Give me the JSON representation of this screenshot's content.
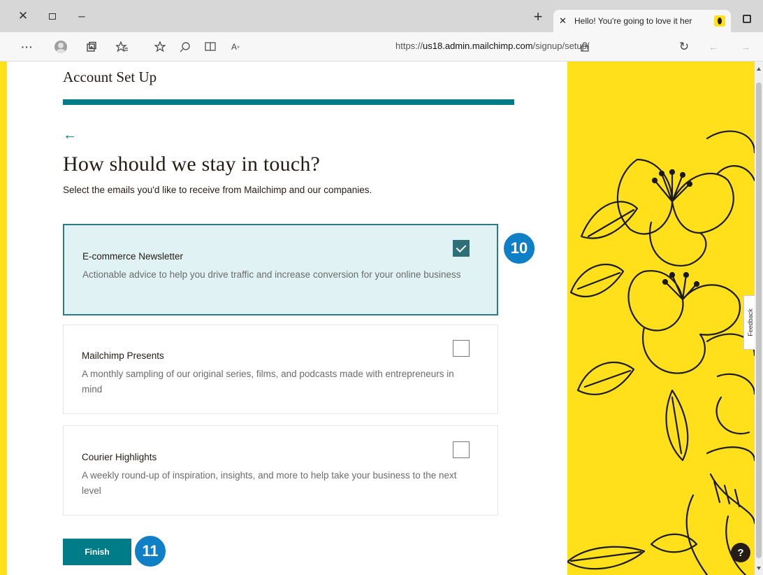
{
  "browser": {
    "tab_title": "Hello! You're going to love it her",
    "url_prefix": "https://",
    "url_domain": "us18.admin.mailchimp.com",
    "url_path": "/signup/setup/",
    "icons": {
      "close": "close-icon",
      "restore": "restore-icon",
      "minimize": "minimize-icon",
      "new_tab": "plus-icon",
      "more": "more-icon",
      "profile": "profile-icon",
      "collections": "collections-icon",
      "favorites": "favorites-icon",
      "add_favorite": "add-favorite-icon",
      "zoom": "zoom-icon",
      "immersive": "immersive-reader-icon",
      "read_aloud": "read-aloud-icon",
      "lock": "lock-icon",
      "refresh": "refresh-icon",
      "back": "back-icon",
      "forward": "forward-icon"
    }
  },
  "page": {
    "setup_title": "Account Set Up",
    "heading": "How should we stay in touch?",
    "subheading": "Select the emails you'd like to receive from Mailchimp and our companies.",
    "options": [
      {
        "name": "E-commerce Newsletter",
        "description": "Actionable advice to help you drive traffic and increase conversion for your online business",
        "checked": true
      },
      {
        "name": "Mailchimp Presents",
        "description": "A monthly sampling of our original series, films, and podcasts made with entrepreneurs in mind",
        "checked": false
      },
      {
        "name": "Courier Highlights",
        "description": "A weekly round-up of inspiration, insights, and more to help take your business to the next level",
        "checked": false
      }
    ],
    "finish_label": "Finish",
    "feedback_label": "Feedback",
    "help_label": "?"
  },
  "annotations": {
    "step_10": "10",
    "step_11": "11"
  },
  "colors": {
    "brand_yellow": "#ffe01b",
    "teal": "#007c89",
    "selected_bg": "#e0f2f3",
    "badge_blue": "#0f7fc6"
  }
}
